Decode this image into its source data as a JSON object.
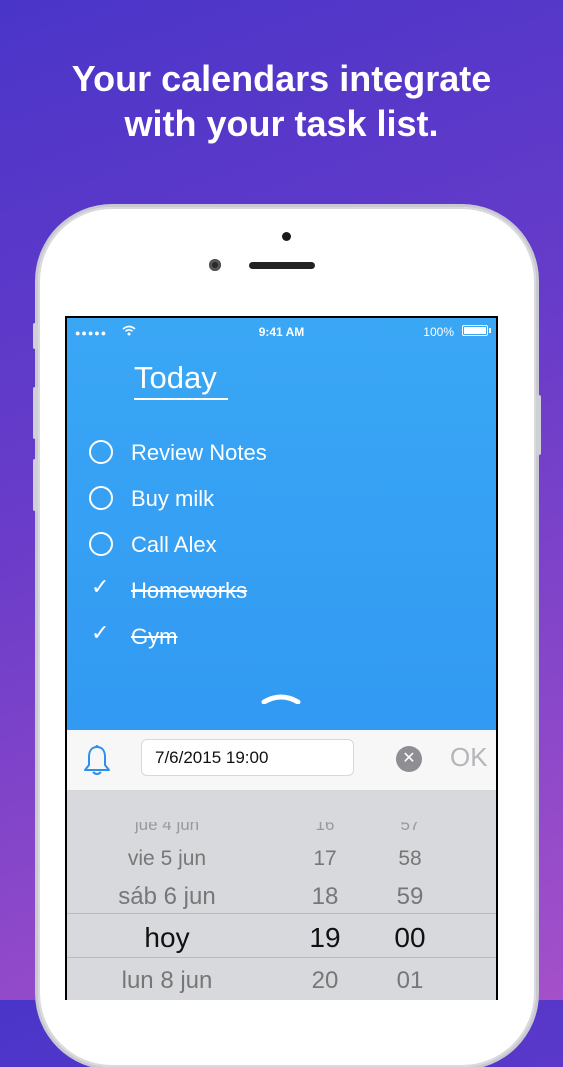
{
  "headline": {
    "line1": "Your calendars integrate",
    "line2": "with your task list."
  },
  "status_bar": {
    "signal": "●●●●●",
    "time": "9:41 AM",
    "battery": "100%"
  },
  "list": {
    "title": "Today",
    "tasks": [
      {
        "label": "Review Notes",
        "done": false
      },
      {
        "label": "Buy milk",
        "done": false
      },
      {
        "label": "Call Alex",
        "done": false
      },
      {
        "label": "Homeworks",
        "done": true
      },
      {
        "label": "Gym",
        "done": true
      }
    ]
  },
  "reminder": {
    "date_value": "7/6/2015 19:00",
    "ok_label": "OK",
    "clear_glyph": "✕"
  },
  "picker": {
    "days": [
      "jue 4 jun",
      "vie 5 jun",
      "sáb 6 jun",
      "hoy",
      "lun 8 jun"
    ],
    "hours": [
      "16",
      "17",
      "18",
      "19",
      "20"
    ],
    "minutes": [
      "57",
      "58",
      "59",
      "00",
      "01"
    ]
  },
  "icons": {
    "check": "✓",
    "wifi": "wifi-icon",
    "bell": "bell-icon",
    "chevron": "chevron-up-icon"
  },
  "colors": {
    "accent": "#2b8ff0",
    "bell": "#2b8ff0"
  }
}
